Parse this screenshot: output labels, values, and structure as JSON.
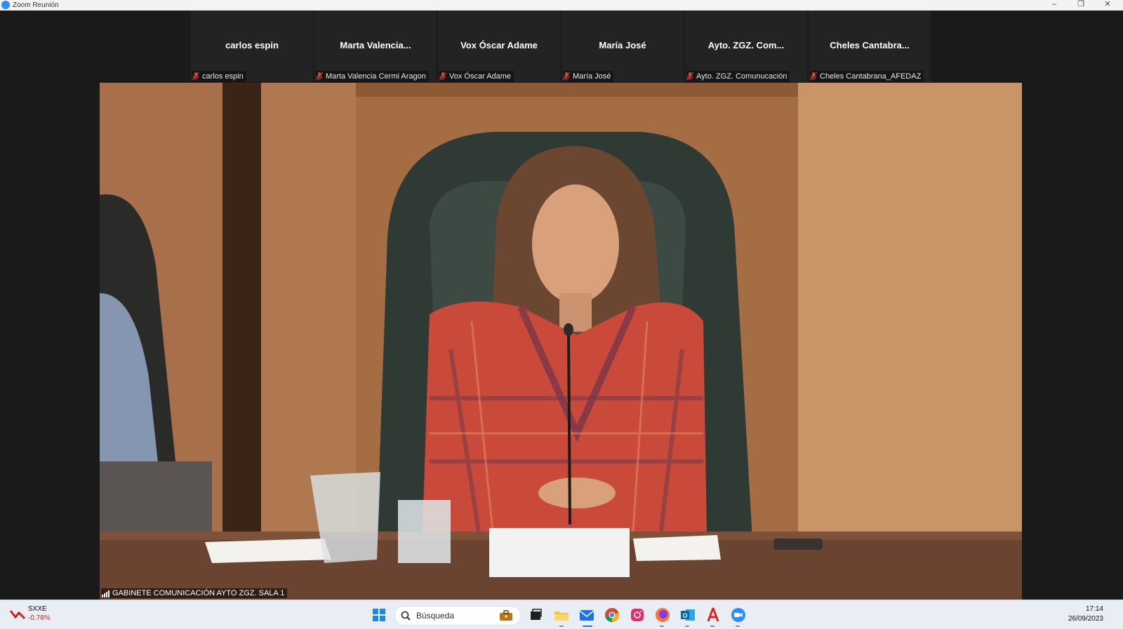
{
  "window": {
    "title": "Zoom Reunión"
  },
  "participants": [
    {
      "name": "carlos espin",
      "label": "carlos espin"
    },
    {
      "name": "Marta  Valencia...",
      "label": "Marta Valencia Cermi Aragon"
    },
    {
      "name": "Vox Óscar Adame",
      "label": "Vox Óscar Adame"
    },
    {
      "name": "María José",
      "label": "María José"
    },
    {
      "name": "Ayto. ZGZ. Com...",
      "label": "Ayto. ZGZ. Comunucación"
    },
    {
      "name": "Cheles  Cantabra...",
      "label": "Cheles Cantabrana_AFEDAZ"
    }
  ],
  "main_video": {
    "label": "GABINETE COMUNICACIÓN AYTO ZGZ. SALA 1"
  },
  "taskbar": {
    "ticker_symbol": "SXXE",
    "ticker_change": "-0.78%",
    "search_placeholder": "Búsqueda",
    "time": "17:14",
    "date": "26/09/2023"
  },
  "colors": {
    "zoom_blue": "#2d8cff",
    "muted_red": "#e0403a",
    "ticker_down": "#d32020"
  }
}
